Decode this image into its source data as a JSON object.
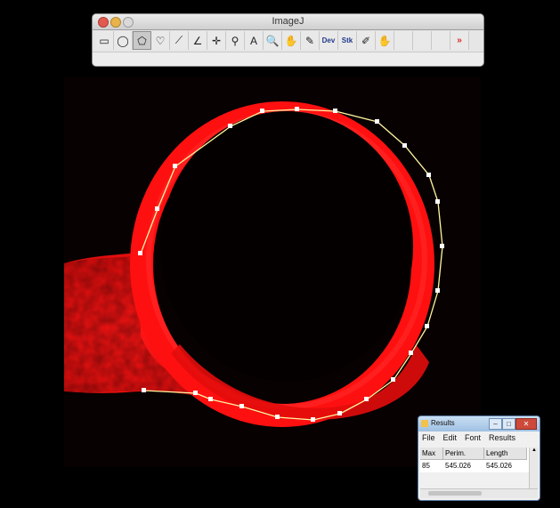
{
  "ij_window": {
    "title": "ImageJ",
    "tools": [
      {
        "icon": "rectangle-select-icon",
        "glyph": "▭"
      },
      {
        "icon": "oval-select-icon",
        "glyph": "◯"
      },
      {
        "icon": "polygon-select-icon",
        "glyph": "⬠"
      },
      {
        "icon": "freehand-select-icon",
        "glyph": "♡"
      },
      {
        "icon": "line-tool-icon",
        "glyph": "⟋"
      },
      {
        "icon": "angle-tool-icon",
        "glyph": "∠"
      },
      {
        "icon": "point-tool-icon",
        "glyph": "✛"
      },
      {
        "icon": "wand-tool-icon",
        "glyph": "⚲"
      },
      {
        "icon": "text-tool-icon",
        "glyph": "A"
      },
      {
        "icon": "magnifier-icon",
        "glyph": "🔍"
      },
      {
        "icon": "hand-tool-icon",
        "glyph": "✋"
      },
      {
        "icon": "dropper-icon",
        "glyph": "✎"
      },
      {
        "icon": "dev-menu-icon",
        "glyph": "Dev"
      },
      {
        "icon": "stk-menu-icon",
        "glyph": "Stk"
      },
      {
        "icon": "brush-tool-icon",
        "glyph": "✐"
      },
      {
        "icon": "flood-fill-icon",
        "glyph": "✋"
      }
    ],
    "more_glyph": "»",
    "selected_tool_index": 2
  },
  "results": {
    "title": "Results",
    "menu": [
      "File",
      "Edit",
      "Font",
      "Results"
    ],
    "columns": [
      "Max",
      "Perim.",
      "Length"
    ],
    "rows": [
      [
        "85",
        "545.026",
        "545.026"
      ]
    ]
  },
  "colors": {
    "signal": "#ff1010",
    "selection": "#fff6a0",
    "background": "#000000"
  }
}
